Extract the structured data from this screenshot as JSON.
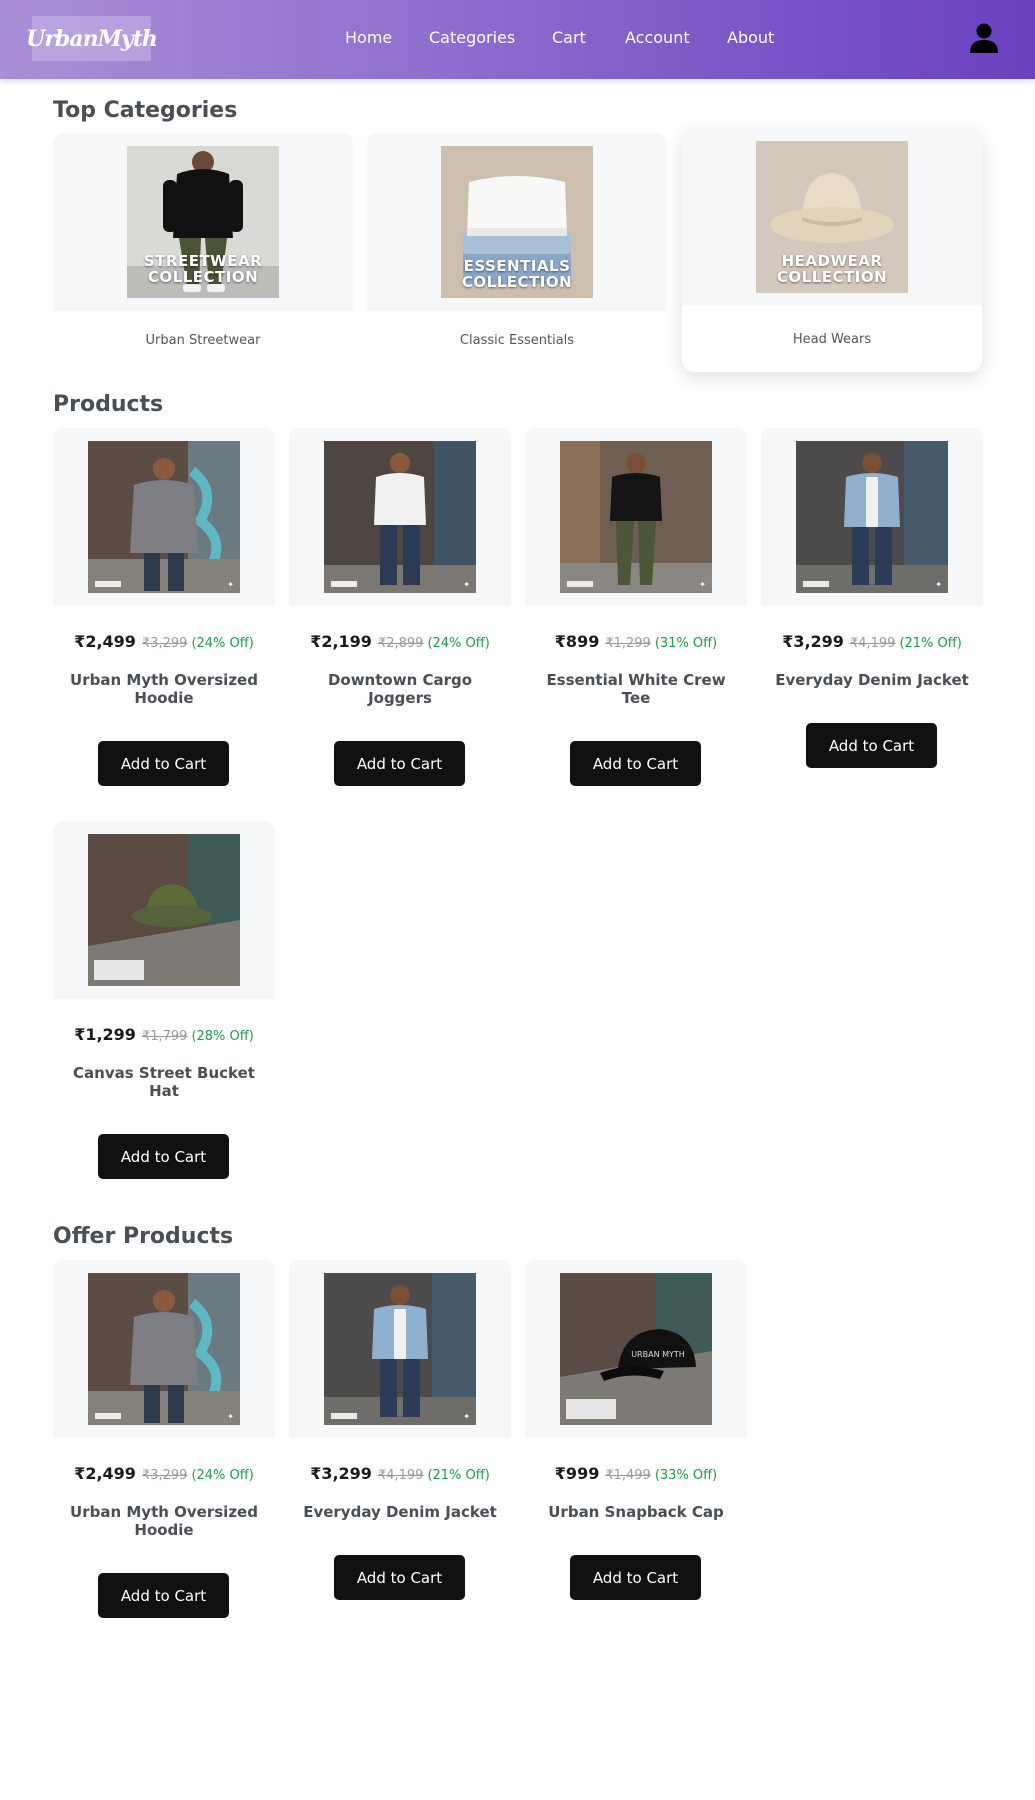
{
  "header": {
    "logo_text": "UrbanMyth",
    "nav": [
      "Home",
      "Categories",
      "Cart",
      "Account",
      "About"
    ],
    "account_icon": "user-icon"
  },
  "sections": {
    "top_categories": "Top Categories",
    "products": "Products",
    "offer_products": "Offer Products"
  },
  "categories": [
    {
      "label": "Urban Streetwear",
      "overlay": [
        "STREETWEAR",
        "COLLECTION"
      ]
    },
    {
      "label": "Classic Essentials",
      "overlay": [
        "ESSENTIALS",
        "COLLECTION"
      ]
    },
    {
      "label": "Head Wears",
      "overlay": [
        "HEADWEAR",
        "COLLECTION"
      ]
    }
  ],
  "products": [
    {
      "price": "₹2,499",
      "old_price": "₹3,299",
      "off": "(24% Off)",
      "name": "Urban Myth Oversized Hoodie",
      "button": "Add to Cart"
    },
    {
      "price": "₹2,199",
      "old_price": "₹2,899",
      "off": "(24% Off)",
      "name": "Downtown Cargo Joggers",
      "button": "Add to Cart"
    },
    {
      "price": "₹899",
      "old_price": "₹1,299",
      "off": "(31% Off)",
      "name": "Essential White Crew Tee",
      "button": "Add to Cart"
    },
    {
      "price": "₹3,299",
      "old_price": "₹4,199",
      "off": "(21% Off)",
      "name": "Everyday Denim Jacket",
      "button": "Add to Cart"
    },
    {
      "price": "₹1,299",
      "old_price": "₹1,799",
      "off": "(28% Off)",
      "name": "Canvas Street Bucket Hat",
      "button": "Add to Cart"
    }
  ],
  "offer_products": [
    {
      "price": "₹2,499",
      "old_price": "₹3,299",
      "off": "(24% Off)",
      "name": "Urban Myth Oversized Hoodie",
      "button": "Add to Cart"
    },
    {
      "price": "₹3,299",
      "old_price": "₹4,199",
      "off": "(21% Off)",
      "name": "Everyday Denim Jacket",
      "button": "Add to Cart"
    },
    {
      "price": "₹999",
      "old_price": "₹1,499",
      "off": "(33% Off)",
      "name": "Urban Snapback Cap",
      "button": "Add to Cart"
    }
  ],
  "snapback_print": "URBAN MYTH",
  "colors": {
    "header_start": "#a98fd6",
    "header_end": "#6a40c0",
    "button": "#111111",
    "discount": "#1f9a4a"
  }
}
